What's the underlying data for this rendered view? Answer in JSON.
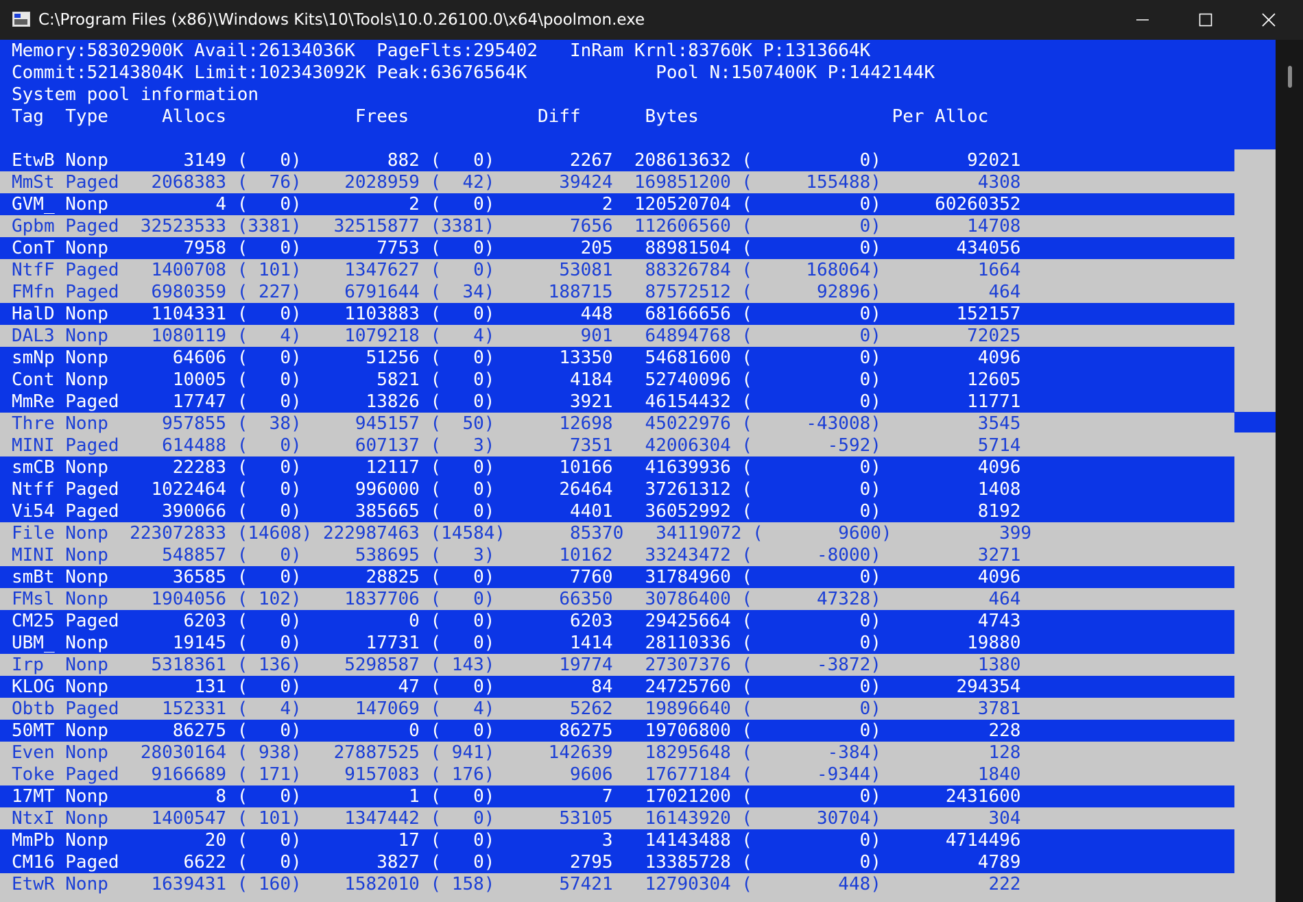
{
  "window": {
    "title": "C:\\Program Files (x86)\\Windows Kits\\10\\Tools\\10.0.26100.0\\x64\\poolmon.exe"
  },
  "colors": {
    "console_blue": "#0c36e6",
    "console_gray": "#c8c8c8",
    "selected_text": "#ffffff",
    "unselected_text": "#1a3ed6",
    "titlebar": "#202020"
  },
  "icons": [
    "console-app-icon",
    "minimize-icon",
    "maximize-icon",
    "close-icon"
  ],
  "header": {
    "line1": "Memory:58302900K Avail:26134036K  PageFlts:295402   InRam Krnl:83760K P:1313664K",
    "line2": "Commit:52143804K Limit:102343092K Peak:63676564K            Pool N:1507400K P:1442144K",
    "line3": "System pool information",
    "columns": "Tag  Type     Allocs            Frees            Diff      Bytes                  Per Alloc"
  },
  "rows": [
    {
      "line": "EtwB Nonp       3149 (   0)        882 (   0)       2267  208613632 (          0)        92021",
      "selected": true
    },
    {
      "line": "MmSt Paged   2068383 (  76)    2028959 (  42)      39424  169851200 (     155488)         4308",
      "selected": false
    },
    {
      "line": "GVM_ Nonp          4 (   0)          2 (   0)          2  120520704 (          0)     60260352",
      "selected": true
    },
    {
      "line": "Gpbm Paged  32523533 (3381)   32515877 (3381)       7656  112606560 (          0)        14708",
      "selected": false
    },
    {
      "line": "ConT Nonp       7958 (   0)       7753 (   0)        205   88981504 (          0)       434056",
      "selected": true
    },
    {
      "line": "NtfF Paged   1400708 ( 101)    1347627 (   0)      53081   88326784 (     168064)         1664",
      "selected": false
    },
    {
      "line": "FMfn Paged   6980359 ( 227)    6791644 (  34)     188715   87572512 (      92896)          464",
      "selected": false
    },
    {
      "line": "HalD Nonp    1104331 (   0)    1103883 (   0)        448   68166656 (          0)       152157",
      "selected": true
    },
    {
      "line": "DAL3 Nonp    1080119 (   4)    1079218 (   4)        901   64894768 (          0)        72025",
      "selected": false
    },
    {
      "line": "smNp Nonp      64606 (   0)      51256 (   0)      13350   54681600 (          0)         4096",
      "selected": true
    },
    {
      "line": "Cont Nonp      10005 (   0)       5821 (   0)       4184   52740096 (          0)        12605",
      "selected": true
    },
    {
      "line": "MmRe Paged     17747 (   0)      13826 (   0)       3921   46154432 (          0)        11771",
      "selected": true
    },
    {
      "line": "Thre Nonp     957855 (  38)     945157 (  50)      12698   45022976 (     -43008)         3545",
      "selected": false
    },
    {
      "line": "MINI Paged    614488 (   0)     607137 (   3)       7351   42006304 (       -592)         5714",
      "selected": false
    },
    {
      "line": "smCB Nonp      22283 (   0)      12117 (   0)      10166   41639936 (          0)         4096",
      "selected": true
    },
    {
      "line": "Ntff Paged   1022464 (   0)     996000 (   0)      26464   37261312 (          0)         1408",
      "selected": true
    },
    {
      "line": "Vi54 Paged    390066 (   0)     385665 (   0)       4401   36052992 (          0)         8192",
      "selected": true
    },
    {
      "line": "File Nonp  223072833 (14608) 222987463 (14584)      85370   34119072 (       9600)          399",
      "selected": false
    },
    {
      "line": "MINI Nonp     548857 (   0)     538695 (   3)      10162   33243472 (      -8000)         3271",
      "selected": false
    },
    {
      "line": "smBt Nonp      36585 (   0)      28825 (   0)       7760   31784960 (          0)         4096",
      "selected": true
    },
    {
      "line": "FMsl Nonp    1904056 ( 102)    1837706 (   0)      66350   30786400 (      47328)          464",
      "selected": false
    },
    {
      "line": "CM25 Paged      6203 (   0)          0 (   0)       6203   29425664 (          0)         4743",
      "selected": true
    },
    {
      "line": "UBM_ Nonp      19145 (   0)      17731 (   0)       1414   28110336 (          0)        19880",
      "selected": true
    },
    {
      "line": "Irp  Nonp    5318361 ( 136)    5298587 ( 143)      19774   27307376 (      -3872)         1380",
      "selected": false
    },
    {
      "line": "KLOG Nonp        131 (   0)         47 (   0)         84   24725760 (          0)       294354",
      "selected": true
    },
    {
      "line": "Obtb Paged    152331 (   4)     147069 (   4)       5262   19896640 (          0)         3781",
      "selected": false
    },
    {
      "line": "50MT Nonp      86275 (   0)          0 (   0)      86275   19706800 (          0)          228",
      "selected": true
    },
    {
      "line": "Even Nonp   28030164 ( 938)   27887525 ( 941)     142639   18295648 (       -384)          128",
      "selected": false
    },
    {
      "line": "Toke Paged   9166689 ( 171)    9157083 ( 176)       9606   17677184 (      -9344)         1840",
      "selected": false
    },
    {
      "line": "17MT Nonp          8 (   0)          1 (   0)          7   17021200 (          0)      2431600",
      "selected": true
    },
    {
      "line": "NtxI Nonp    1400547 ( 101)    1347442 (   0)      53105   16143920 (      30704)          304",
      "selected": false
    },
    {
      "line": "MmPb Nonp         20 (   0)         17 (   0)          3   14143488 (          0)      4714496",
      "selected": true
    },
    {
      "line": "CM16 Paged      6622 (   0)       3827 (   0)       2795   13385728 (          0)         4789",
      "selected": true
    },
    {
      "line": "EtwR Nonp    1639431 ( 160)    1582010 ( 158)      57421   12790304 (        448)          222",
      "selected": false
    }
  ]
}
